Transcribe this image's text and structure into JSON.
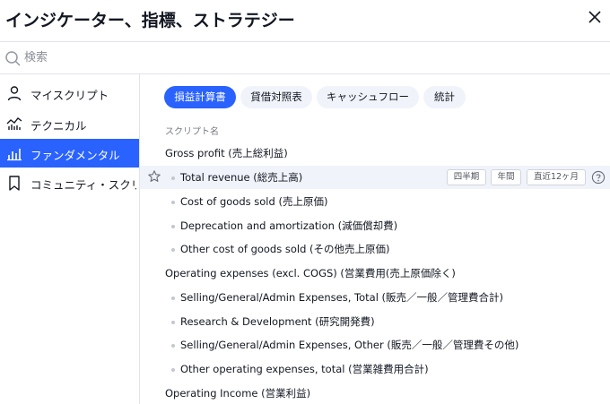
{
  "dialog": {
    "title": "インジケーター、指標、ストラテジー"
  },
  "search": {
    "placeholder": "検索"
  },
  "sidebar": {
    "items": [
      {
        "label": "マイスクリプト",
        "icon": "user-icon"
      },
      {
        "label": "テクニカル",
        "icon": "technical-chart-icon"
      },
      {
        "label": "ファンダメンタル",
        "icon": "bar-chart-icon",
        "active": true
      },
      {
        "label": "コミュニティ・スクリプト",
        "icon": "bookmark-icon"
      }
    ]
  },
  "tabs": [
    {
      "label": "損益計算書",
      "active": true
    },
    {
      "label": "貸借対照表"
    },
    {
      "label": "キャッシュフロー"
    },
    {
      "label": "統計"
    }
  ],
  "list": {
    "column_header": "スクリプト名",
    "rows": [
      {
        "label": "Gross profit (売上総利益)",
        "type": "group"
      },
      {
        "label": "Total revenue (総売上高)",
        "type": "item",
        "highlighted": true
      },
      {
        "label": "Cost of goods sold (売上原価)",
        "type": "item"
      },
      {
        "label": "Deprecation and amortization (減価償却費)",
        "type": "item"
      },
      {
        "label": "Other cost of goods sold (その他売上原価)",
        "type": "item"
      },
      {
        "label": "Operating expenses (excl. COGS) (営業費用(売上原価除く)",
        "type": "group"
      },
      {
        "label": "Selling/General/Admin Expenses, Total (販売／一般／管理費合計)",
        "type": "item"
      },
      {
        "label": "Research & Development (研究開発費)",
        "type": "item"
      },
      {
        "label": "Selling/General/Admin Expenses, Other (販売／一般／管理費その他)",
        "type": "item"
      },
      {
        "label": "Other operating expenses, total (営業雑費用合計)",
        "type": "item"
      },
      {
        "label": "Operating Income (営業利益)",
        "type": "group"
      }
    ],
    "badges": [
      "四半期",
      "年間",
      "直近12ヶ月"
    ]
  },
  "colors": {
    "accent": "#2962ff",
    "highlight_row": "#f0f3fa",
    "tab_bg": "#f0f3fa"
  }
}
